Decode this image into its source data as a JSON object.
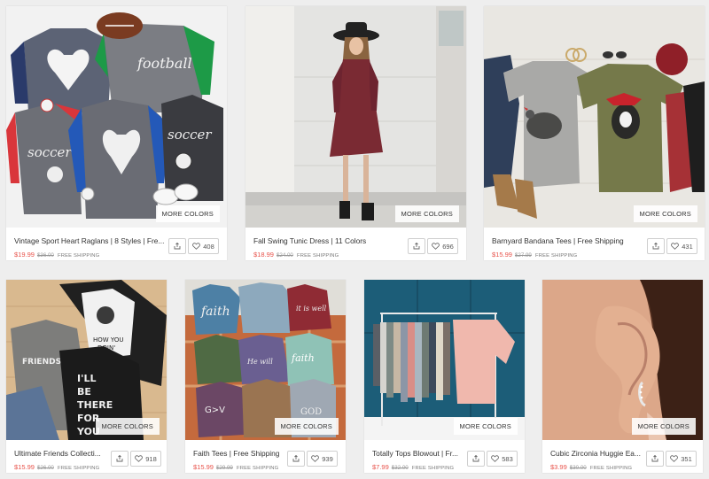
{
  "more_colors_label": "MORE COLORS",
  "products": [
    {
      "title": "Vintage Sport Heart Raglans | 8 Styles | Fre...",
      "price": "$19.99",
      "original_price": "$36.00",
      "shipping": "FREE SHIPPING",
      "likes": "408"
    },
    {
      "title": "Fall Swing Tunic Dress | 11 Colors",
      "price": "$18.99",
      "original_price": "$24.00",
      "shipping": "FREE SHIPPING",
      "likes": "696"
    },
    {
      "title": "Barnyard Bandana Tees | Free Shipping",
      "price": "$15.99",
      "original_price": "$27.99",
      "shipping": "FREE SHIPPING",
      "likes": "431"
    },
    {
      "title": "Ultimate Friends Collecti...",
      "price": "$15.99",
      "original_price": "$26.00",
      "shipping": "FREE SHIPPING",
      "likes": "918"
    },
    {
      "title": "Faith Tees | Free Shipping",
      "price": "$15.99",
      "original_price": "$29.99",
      "shipping": "FREE SHIPPING",
      "likes": "939"
    },
    {
      "title": "Totally Tops Blowout | Fr...",
      "price": "$7.99",
      "original_price": "$32.00",
      "shipping": "FREE SHIPPING",
      "likes": "583"
    },
    {
      "title": "Cubic Zirconia Huggie Ea...",
      "price": "$3.99",
      "original_price": "$30.00",
      "shipping": "FREE SHIPPING",
      "likes": "351"
    }
  ],
  "icons": {
    "share": "share-icon",
    "like": "heart-icon"
  }
}
